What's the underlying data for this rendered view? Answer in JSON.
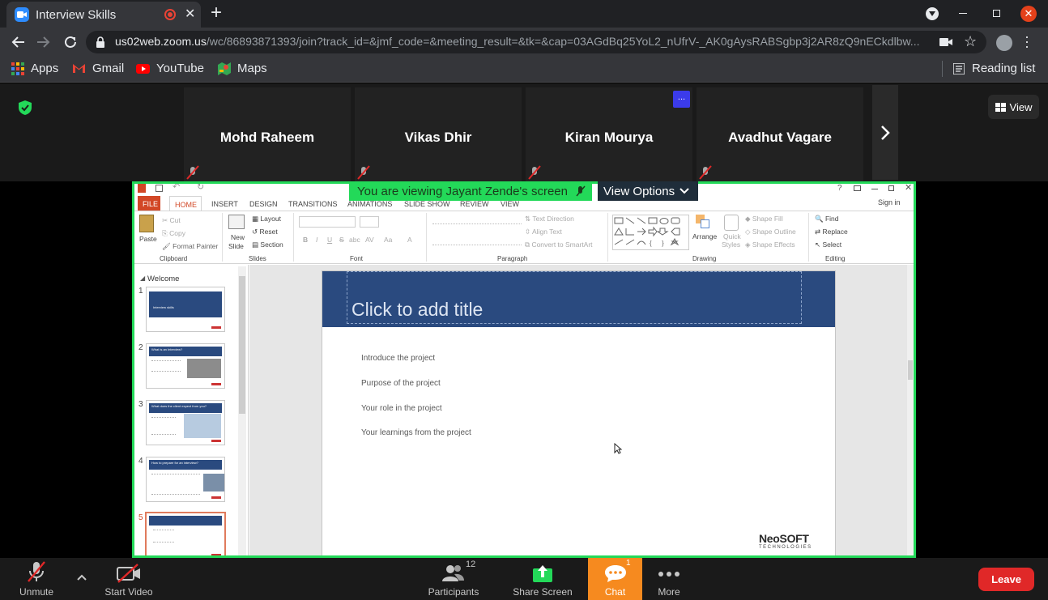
{
  "browser": {
    "tab_title": "Interview Skills",
    "new_tab": "+",
    "url_host": "us02web.zoom.us",
    "url_path": "/wc/86893871393/join?track_id=&jmf_code=&meeting_result=&tk=&cap=03AGdBq25YoL2_nUfrV-_AK0gAysRABSgbp3j2AR8zQ9nECkdlbw...",
    "bookmarks": [
      "Apps",
      "Gmail",
      "YouTube",
      "Maps"
    ],
    "reading_list": "Reading list"
  },
  "zoom": {
    "participants_tiles": [
      "Mohd Raheem",
      "Vikas Dhir",
      "Kiran Mourya",
      "Avadhut Vagare"
    ],
    "more_badge": "...",
    "view_label": "View",
    "banner_text": "You are viewing Jayant Zende's screen",
    "view_options": "View Options",
    "toolbar": {
      "unmute": "Unmute",
      "start_video": "Start Video",
      "participants": "Participants",
      "participants_count": "12",
      "share_screen": "Share Screen",
      "chat": "Chat",
      "chat_count": "1",
      "more": "More",
      "leave": "Leave"
    },
    "colors": {
      "accent_green": "#23d959",
      "chat_orange": "#f68a1f",
      "leave_red": "#e02828"
    }
  },
  "powerpoint": {
    "tabs": [
      "FILE",
      "HOME",
      "INSERT",
      "DESIGN",
      "TRANSITIONS",
      "ANIMATIONS",
      "SLIDE SHOW",
      "REVIEW",
      "VIEW"
    ],
    "sign_in": "Sign in",
    "clipboard": {
      "paste": "Paste",
      "cut": "Cut",
      "copy": "Copy",
      "format_painter": "Format Painter",
      "group": "Clipboard"
    },
    "slides": {
      "new_slide_1": "New",
      "new_slide_2": "Slide",
      "layout": "Layout",
      "reset": "Reset",
      "section": "Section",
      "group": "Slides"
    },
    "font": {
      "group": "Font",
      "bold": "B",
      "italic": "I",
      "underline": "U",
      "strike": "S",
      "shadow": "abc",
      "spacing": "AV",
      "case": "Aa",
      "color": "A"
    },
    "paragraph": {
      "group": "Paragraph",
      "text_direction": "Text Direction",
      "align_text": "Align Text",
      "smartart": "Convert to SmartArt"
    },
    "drawing": {
      "group": "Drawing",
      "arrange": "Arrange",
      "quick_styles_1": "Quick",
      "quick_styles_2": "Styles",
      "shape_fill": "Shape Fill",
      "shape_outline": "Shape Outline",
      "shape_effects": "Shape Effects"
    },
    "editing": {
      "group": "Editing",
      "find": "Find",
      "replace": "Replace",
      "select": "Select"
    },
    "section_name": "Welcome",
    "thumb_titles": [
      "Interview skills",
      "What is an Interview?",
      "What does the client expect from you?",
      "How to prepare for an interview?"
    ],
    "slide": {
      "title_placeholder": "Click to add title",
      "bullets": [
        "Introduce the project",
        "Purpose of the project",
        "Your role in the project",
        "Your learnings from the project"
      ],
      "logo_main": "NeoSOFT",
      "logo_sub": "TECHNOLOGIES"
    }
  }
}
